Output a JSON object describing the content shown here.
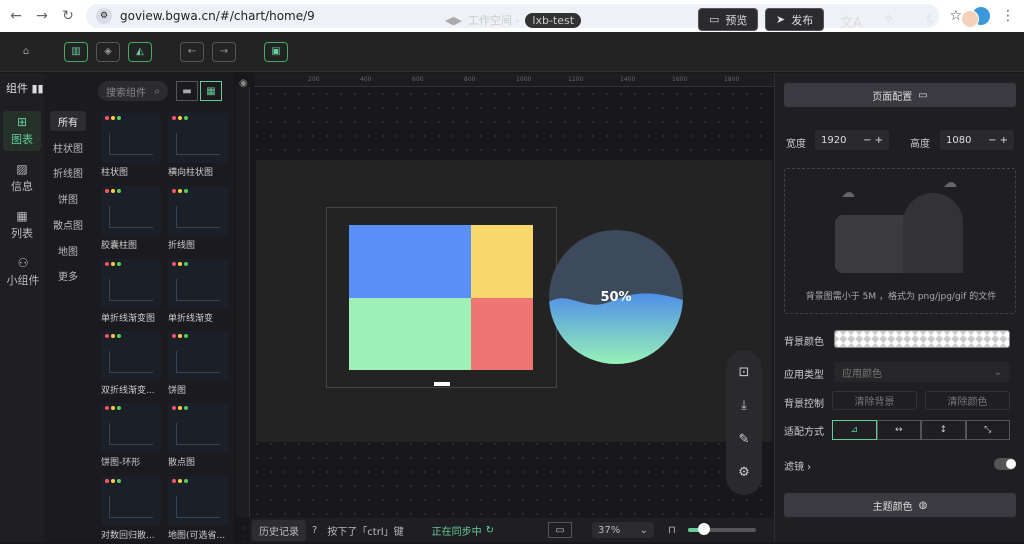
{
  "browser": {
    "url": "goview.bgwa.cn/#/chart/home/9"
  },
  "topbar": {
    "workspace": "工作空间 -",
    "project": "lxb-test",
    "preview_label": "预览",
    "publish_label": "发布"
  },
  "left": {
    "components_label": "组件",
    "categories": [
      {
        "label": "图表",
        "icon": "chart-icon"
      },
      {
        "label": "信息",
        "icon": "info-icon"
      },
      {
        "label": "列表",
        "icon": "table-icon"
      },
      {
        "label": "小组件",
        "icon": "widget-icon"
      }
    ],
    "subcategories": [
      "所有",
      "柱状图",
      "折线图",
      "饼图",
      "散点图",
      "地图",
      "更多"
    ],
    "search_placeholder": "搜索组件",
    "cards": [
      "柱状图",
      "横向柱状图",
      "胶囊柱图",
      "折线图",
      "单折线渐变图",
      "单折线渐变",
      "双折线渐变...",
      "饼图",
      "饼图-环形",
      "散点图",
      "对数回归散...",
      "地图(可选省..."
    ]
  },
  "canvas": {
    "ruler_ticks": [
      "200",
      "400",
      "600",
      "800",
      "1000",
      "1200",
      "1400",
      "1600",
      "1800"
    ],
    "percent": "50%"
  },
  "bottom": {
    "history_label": "历史记录",
    "key_hint": "按下了「ctrl」键",
    "sync_status": "正在同步中",
    "zoom": "37%"
  },
  "right": {
    "page_config": "页面配置",
    "width_label": "宽度",
    "width_value": "1920",
    "height_label": "高度",
    "height_value": "1080",
    "upload_hint": "背景图需小于 5M ，格式为 png/jpg/gif 的文件",
    "bg_color_label": "背景颜色",
    "app_type_label": "应用类型",
    "app_type_value": "应用颜色",
    "bg_control_label": "背景控制",
    "clear_bg": "清除背景",
    "clear_color": "清除颜色",
    "fit_label": "适配方式",
    "filter_label": "滤镜",
    "theme_color": "主题颜色"
  },
  "colors": {
    "accent": "#66cc99",
    "blue": "#5b8ff9",
    "yellow": "#f6d86b",
    "green": "#9ef0b8",
    "red": "#ef7474"
  }
}
